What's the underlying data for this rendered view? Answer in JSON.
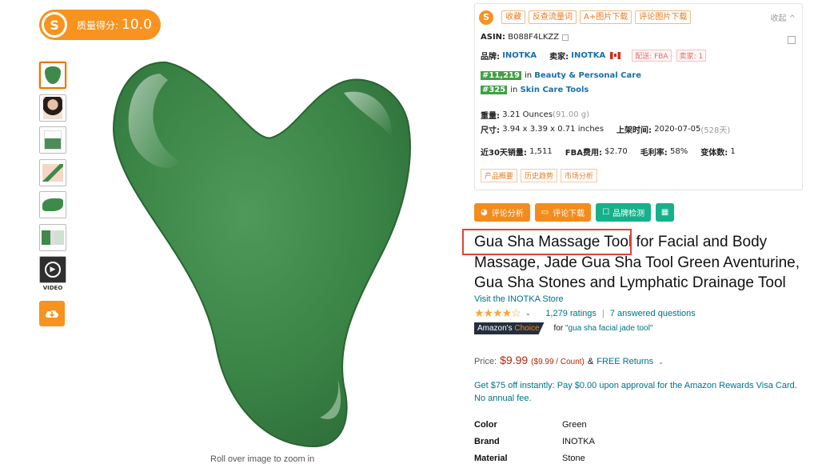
{
  "quality": {
    "label": "质量得分:",
    "score": "10.0"
  },
  "thumbnails": {
    "video_label": "VIDEO"
  },
  "zoom_hint": "Roll over image to zoom in",
  "plugin": {
    "buttons": [
      "收藏",
      "反查流量词",
      "A+图片下载",
      "评论图片下载"
    ],
    "collapse": "收起 ^",
    "asin_label": "ASIN:",
    "asin": "B088F4LKZZ",
    "brand_label": "品牌:",
    "brand": "INOTKA",
    "seller_label": "卖家:",
    "seller": "INOTKA",
    "fulfillment": "配送: FBA",
    "seller_count": "卖家: 1",
    "rank1": "#11,219",
    "rank1_in": "in",
    "rank1_cat": "Beauty & Personal Care",
    "rank2": "#325",
    "rank2_in": "in",
    "rank2_cat": "Skin Care Tools",
    "weight_label": "重量:",
    "weight": "3.21 Ounces",
    "weight_g": "(91.00 g)",
    "size_label": "尺寸:",
    "size": "3.94 x 3.39 x 0.71 inches",
    "listed_label": "上架时间:",
    "listed": "2020-07-05",
    "listed_days": "(528天)",
    "sales_label": "近30天销量:",
    "sales": "1,511",
    "fba_label": "FBA费用:",
    "fba": "$2.70",
    "margin_label": "毛利率:",
    "margin": "58%",
    "variants_label": "变体数:",
    "variants": "1",
    "tabs": [
      "产品概要",
      "历史趋势",
      "市场分析"
    ]
  },
  "actions": {
    "review_analysis": "评论分析",
    "review_download": "评论下载",
    "brand_check": "品牌检测"
  },
  "product": {
    "title_part1": "Gua Sha Massage Tool",
    "title_part2": " for Facial and Body Massage, Jade Gua Sha Tool Green Aventurine, Gua Sha Stones and Lymphatic Drainage Tool",
    "store_link": "Visit the INOTKA Store",
    "stars": "★★★★☆",
    "ratings": "1,279 ratings",
    "separator": "|",
    "questions": "7 answered questions",
    "choice_prefix": "Amazon's",
    "choice_word": "Choice",
    "choice_for": "for",
    "choice_term": "\"gua sha facial jade tool\"",
    "price_label": "Price:",
    "price": "$9.99",
    "unit_price": "($9.99 / Count)",
    "amp": "&",
    "free_returns": "FREE Returns",
    "promo": "Get $75 off instantly: Pay $0.00 upon approval for the Amazon Rewards Visa Card. No annual fee.",
    "specs": [
      {
        "key": "Color",
        "value": "Green"
      },
      {
        "key": "Brand",
        "value": "INOTKA"
      },
      {
        "key": "Material",
        "value": "Stone"
      }
    ]
  },
  "colors": {
    "accent_orange": "#f7931e",
    "link": "#007185",
    "price": "#b12704",
    "highlight_red": "#e2443a",
    "jade": "#3e8a4a"
  }
}
